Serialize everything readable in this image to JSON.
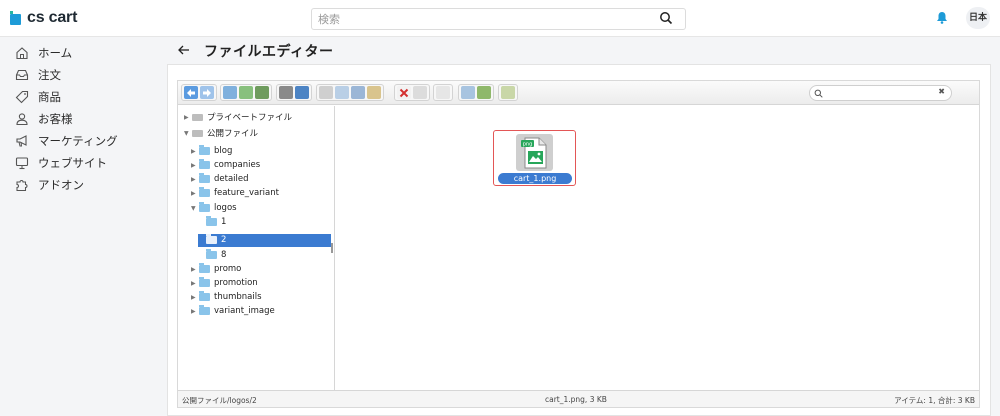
{
  "app": {
    "logo_text": "cs cart"
  },
  "header": {
    "search_placeholder": "検索",
    "language_label": "日本",
    "accent": "#1e9bd7"
  },
  "sidebar": {
    "items": [
      {
        "label": "ホーム",
        "icon": "home-icon"
      },
      {
        "label": "注文",
        "icon": "inbox-icon"
      },
      {
        "label": "商品",
        "icon": "tag-icon"
      },
      {
        "label": "お客様",
        "icon": "user-icon"
      },
      {
        "label": "マーケティング",
        "icon": "megaphone-icon"
      },
      {
        "label": "ウェブサイト",
        "icon": "monitor-icon"
      },
      {
        "label": "アドオン",
        "icon": "puzzle-icon"
      }
    ]
  },
  "page": {
    "title": "ファイルエディター",
    "back_icon": "arrow-left-icon"
  },
  "file_manager": {
    "tree": {
      "roots": [
        {
          "label": "プライベートファイル",
          "expanded": false
        },
        {
          "label": "公開ファイル",
          "expanded": true
        }
      ],
      "public_children": [
        "blog",
        "companies",
        "detailed",
        "feature_variant",
        "logos",
        "promo",
        "promotion",
        "thumbnails",
        "variant_image"
      ],
      "logos_children": [
        "1",
        "2",
        "8"
      ],
      "selected": "2"
    },
    "files": [
      {
        "name": "cart_1.png",
        "badge": "png",
        "selected": true
      }
    ],
    "status": {
      "path": "公開ファイル/logos/2",
      "selected_info": "cart_1.png, 3 KB",
      "summary": "アイテム: 1, 合計: 3 KB"
    }
  }
}
